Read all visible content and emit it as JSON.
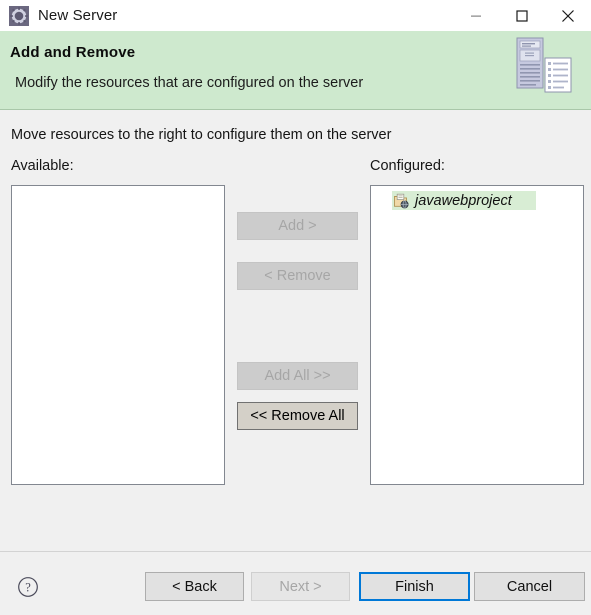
{
  "window": {
    "title": "New Server",
    "icon": "server-gear-icon",
    "controls": {
      "minimize": "minimize-icon",
      "maximize": "maximize-icon",
      "close": "close-icon"
    }
  },
  "header": {
    "title": "Add and Remove",
    "subtitle": "Modify the resources that are configured on the server",
    "banner_icon": "server-and-document-icon",
    "background_color": "#cee9ce"
  },
  "main": {
    "instruction": "Move resources to the right to configure them on the server",
    "available": {
      "label": "Available:",
      "items": []
    },
    "configured": {
      "label": "Configured:",
      "items": [
        {
          "label": "javawebproject",
          "icon": "web-project-icon",
          "selected": true
        }
      ]
    },
    "transfer_buttons": [
      {
        "label": "Add >",
        "enabled": false
      },
      {
        "label": "< Remove",
        "enabled": false
      },
      {
        "label": "Add All >>",
        "enabled": false
      },
      {
        "label": "<< Remove All",
        "enabled": true
      }
    ]
  },
  "footer": {
    "help": "help-icon",
    "buttons": [
      {
        "label": "< Back",
        "enabled": true,
        "focused": false
      },
      {
        "label": "Next >",
        "enabled": false,
        "focused": false
      },
      {
        "label": "Finish",
        "enabled": true,
        "focused": true
      },
      {
        "label": "Cancel",
        "enabled": true,
        "focused": false
      }
    ]
  },
  "colors": {
    "header_green": "#cee9ce",
    "focus_blue": "#0078d7",
    "selection_green": "#d8edd4"
  }
}
